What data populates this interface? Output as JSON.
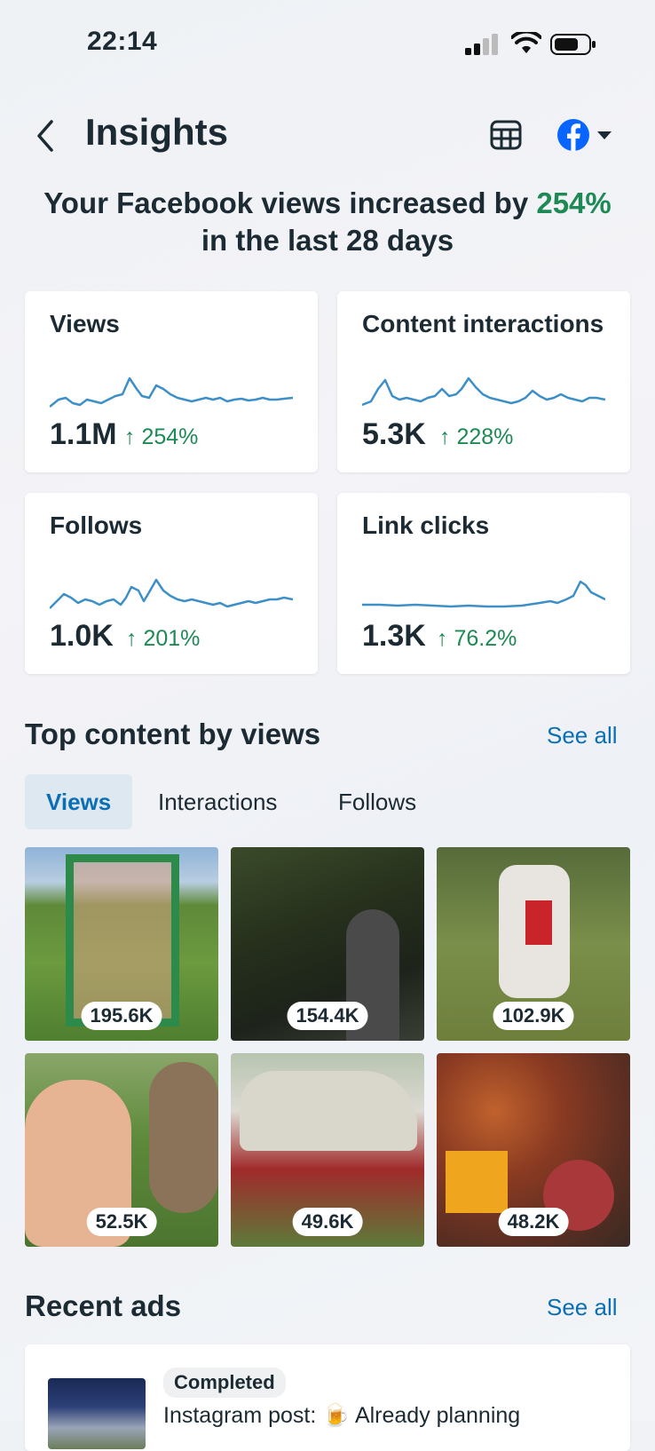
{
  "status_bar": {
    "time": "22:14"
  },
  "header": {
    "title": "Insights"
  },
  "headline": {
    "prefix": "Your Facebook views increased by ",
    "percent": "254%",
    "suffix": "in the last 28 days"
  },
  "metrics": [
    {
      "label": "Views",
      "value": "1.1M",
      "change": "254%"
    },
    {
      "label": "Content interactions",
      "value": "5.3K",
      "change": "228%"
    },
    {
      "label": "Follows",
      "value": "1.0K",
      "change": "201%"
    },
    {
      "label": "Link clicks",
      "value": "1.3K",
      "change": "76.2%"
    }
  ],
  "top_content": {
    "title": "Top content by views",
    "see_all": "See all",
    "tabs": [
      "Views",
      "Interactions",
      "Follows"
    ],
    "active_tab": "Views",
    "items": [
      {
        "views": "195.6K"
      },
      {
        "views": "154.4K"
      },
      {
        "views": "102.9K"
      },
      {
        "views": "52.5K"
      },
      {
        "views": "49.6K"
      },
      {
        "views": "48.2K"
      }
    ]
  },
  "recent_ads": {
    "title": "Recent ads",
    "see_all": "See all",
    "ad": {
      "status": "Completed",
      "text": "Instagram post: 🍺 Already planning"
    }
  },
  "colors": {
    "accent_blue": "#0a6fb5",
    "increase_green": "#1d8a55",
    "sparkline": "#3d8fc8",
    "facebook_blue": "#0866ff"
  },
  "icons": [
    "back-chevron-icon",
    "table-icon",
    "facebook-icon",
    "caret-down-icon",
    "arrow-up-icon",
    "signal-icon",
    "wifi-icon",
    "battery-icon"
  ]
}
